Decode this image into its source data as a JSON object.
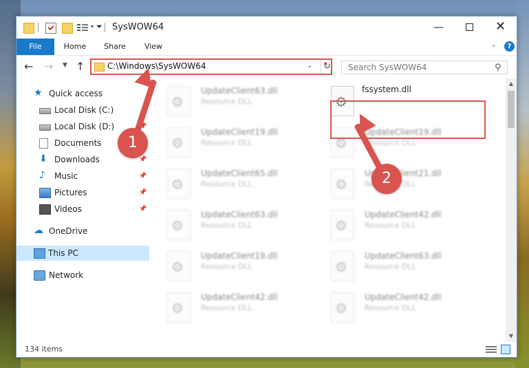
{
  "window": {
    "title": "SysWOW64",
    "controls": {
      "minimize": "—",
      "maximize": "",
      "close": "✕"
    }
  },
  "ribbon": {
    "tabs": [
      {
        "label": "File"
      },
      {
        "label": "Home"
      },
      {
        "label": "Share"
      },
      {
        "label": "View"
      }
    ],
    "help": "?"
  },
  "address": {
    "path": "C:\\Windows\\SysWOW64",
    "search_placeholder": "Search SysWOW64"
  },
  "sidebar": {
    "items": [
      {
        "label": "Quick access"
      },
      {
        "label": "Local Disk (C:)"
      },
      {
        "label": "Local Disk (D:)"
      },
      {
        "label": "Documents"
      },
      {
        "label": "Downloads"
      },
      {
        "label": "Music"
      },
      {
        "label": "Pictures"
      },
      {
        "label": "Videos"
      },
      {
        "label": "OneDrive"
      },
      {
        "label": "This PC"
      },
      {
        "label": "Network"
      }
    ]
  },
  "files": {
    "left": [
      {
        "name": "UpdateClient63.dll",
        "type": "Resource DLL"
      },
      {
        "name": "UpdateClient19.dll",
        "type": "Resource DLL"
      },
      {
        "name": "UpdateClient65.dll",
        "type": "Resource DLL"
      },
      {
        "name": "UpdateClient63.dll",
        "type": "Resource DLL"
      },
      {
        "name": "UpdateClient19.dll",
        "type": "Resource DLL"
      },
      {
        "name": "UpdateClient42.dll",
        "type": "Resource DLL"
      }
    ],
    "right": [
      {
        "name": "fssystem.dll",
        "type": ""
      },
      {
        "name": "UpdateClient19.dll",
        "type": "Resource DLL"
      },
      {
        "name": "UpdateClient21.dll",
        "type": "Resource DLL"
      },
      {
        "name": "UpdateClient42.dll",
        "type": "Resource DLL"
      },
      {
        "name": "UpdateClient63.dll",
        "type": "Resource DLL"
      },
      {
        "name": "UpdateClient42.dll",
        "type": "Resource DLL"
      }
    ]
  },
  "status": {
    "item_count": "134 items"
  },
  "callouts": {
    "one": "1",
    "two": "2",
    "color": "#d9534f"
  }
}
